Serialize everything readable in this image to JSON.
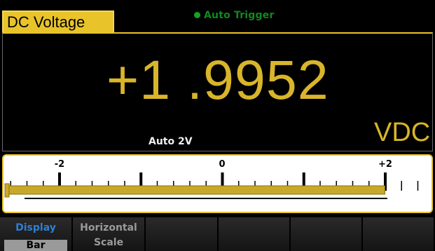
{
  "header": {
    "mode_tab": "DC Voltage",
    "trigger_text": "Auto Trigger"
  },
  "display": {
    "reading": "+1 .9952",
    "range_text": "Auto  2V",
    "unit": "VDC"
  },
  "bar": {
    "labels": [
      "-2",
      "0",
      "+2"
    ],
    "level_value": 1.9952,
    "scale_min": -2,
    "scale_max": 2
  },
  "softkeys": [
    {
      "title": "Display",
      "value": "Bar",
      "active": true
    },
    {
      "title": "Horizontal",
      "subtitle": "Scale",
      "active": false
    },
    {
      "title": "",
      "active": false
    },
    {
      "title": "",
      "active": false
    },
    {
      "title": "",
      "active": false
    },
    {
      "title": "",
      "active": false
    }
  ],
  "colors": {
    "accent": "#e8c42a",
    "reading": "#d8b52a",
    "trigger": "#15a324",
    "active_softkey": "#2f7fd6"
  }
}
